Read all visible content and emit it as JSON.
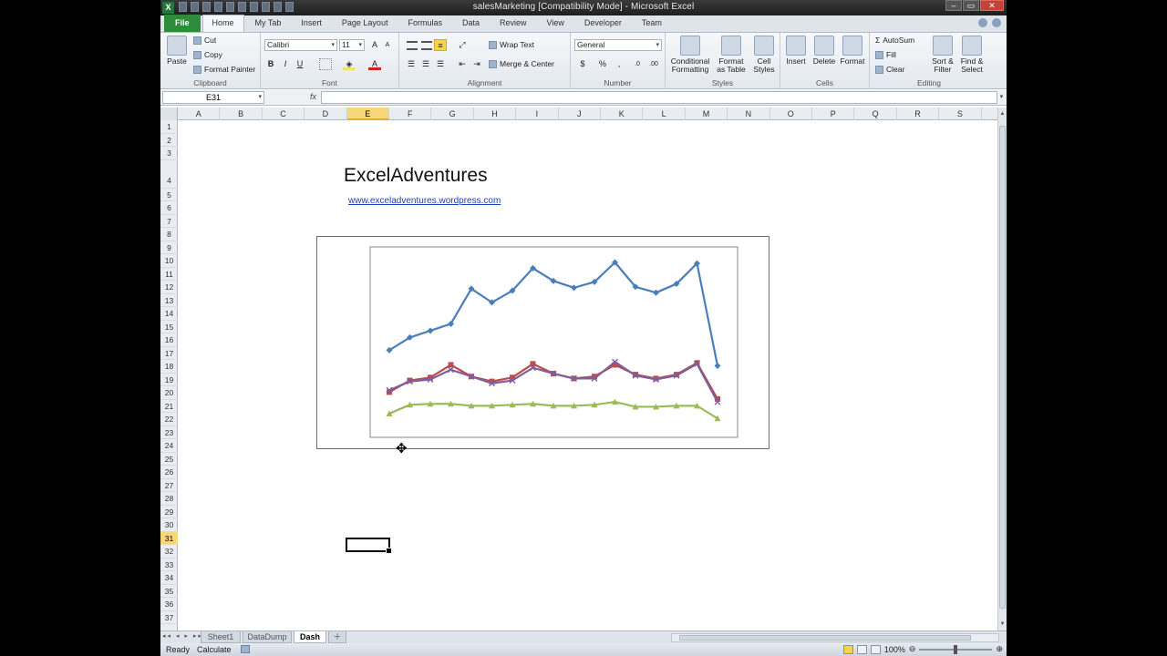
{
  "window": {
    "title": "salesMarketing  [Compatibility Mode]  -  Microsoft Excel"
  },
  "ribbon_tabs": [
    "File",
    "Home",
    "My Tab",
    "Insert",
    "Page Layout",
    "Formulas",
    "Data",
    "Review",
    "View",
    "Developer",
    "Team"
  ],
  "ribbon": {
    "clipboard": {
      "paste": "Paste",
      "cut": "Cut",
      "copy": "Copy",
      "format_painter": "Format Painter",
      "label": "Clipboard"
    },
    "font": {
      "name": "Calibri",
      "size": "11",
      "bold": "B",
      "italic": "I",
      "underline": "U",
      "label": "Font"
    },
    "alignment": {
      "wrap_text": "Wrap Text",
      "merge_center": "Merge & Center",
      "label": "Alignment"
    },
    "number": {
      "format": "General",
      "percent": "%",
      "comma": ",",
      "label": "Number"
    },
    "styles": {
      "conditional": "Conditional",
      "conditional2": "Formatting",
      "format_as": "Format",
      "format_as2": "as Table",
      "cell": "Cell",
      "cell2": "Styles",
      "label": "Styles"
    },
    "cells": {
      "insert": "Insert",
      "delete": "Delete",
      "format": "Format",
      "label": "Cells"
    },
    "editing": {
      "autosum": "AutoSum",
      "fill": "Fill",
      "clear": "Clear",
      "sort": "Sort &",
      "sort2": "Filter",
      "find": "Find &",
      "find2": "Select",
      "label": "Editing"
    }
  },
  "formula_bar": {
    "name_box": "E31",
    "fx": "fx",
    "formula": ""
  },
  "columns": [
    "A",
    "B",
    "C",
    "D",
    "E",
    "F",
    "G",
    "H",
    "I",
    "J",
    "K",
    "L",
    "M",
    "N",
    "O",
    "P",
    "Q",
    "R",
    "S"
  ],
  "selected_column": "E",
  "rows": [
    "1",
    "2",
    "3",
    "4",
    "5",
    "6",
    "7",
    "8",
    "9",
    "10",
    "11",
    "12",
    "13",
    "14",
    "15",
    "16",
    "17",
    "18",
    "19",
    "20",
    "21",
    "22",
    "23",
    "24",
    "25",
    "26",
    "27",
    "28",
    "29",
    "30",
    "31",
    "32",
    "33",
    "34",
    "35",
    "36",
    "37"
  ],
  "selected_row": "31",
  "sheet": {
    "heading": "ExcelAdventures",
    "link": "www.exceladventures.wordpress.com"
  },
  "chart_data": {
    "type": "line",
    "x": [
      1,
      2,
      3,
      4,
      5,
      6,
      7,
      8,
      9,
      10,
      11,
      12,
      13,
      14,
      15,
      16,
      17
    ],
    "series": [
      {
        "color": "#4a7ebb",
        "marker": "diamond",
        "values": [
          100,
          113,
          120,
          127,
          163,
          149,
          161,
          184,
          171,
          164,
          170,
          190,
          165,
          159,
          168,
          189,
          84
        ]
      },
      {
        "color": "#be4b48",
        "marker": "square",
        "values": [
          57,
          69,
          72,
          85,
          73,
          68,
          72,
          86,
          76,
          71,
          73,
          85,
          75,
          71,
          75,
          87,
          50
        ]
      },
      {
        "color": "#7d5fa0",
        "marker": "x",
        "values": [
          59,
          68,
          70,
          80,
          73,
          66,
          69,
          82,
          76,
          71,
          71,
          88,
          74,
          70,
          74,
          86,
          47
        ]
      },
      {
        "color": "#9bbb59",
        "marker": "triangle",
        "values": [
          35,
          44,
          45,
          45,
          43,
          43,
          44,
          45,
          43,
          43,
          44,
          47,
          42,
          42,
          43,
          43,
          30
        ]
      }
    ]
  },
  "sheet_tabs": [
    "Sheet1",
    "DataDump",
    "Dash"
  ],
  "active_sheet": "Dash",
  "status": {
    "ready": "Ready",
    "calculate": "Calculate",
    "zoom": "100%"
  }
}
